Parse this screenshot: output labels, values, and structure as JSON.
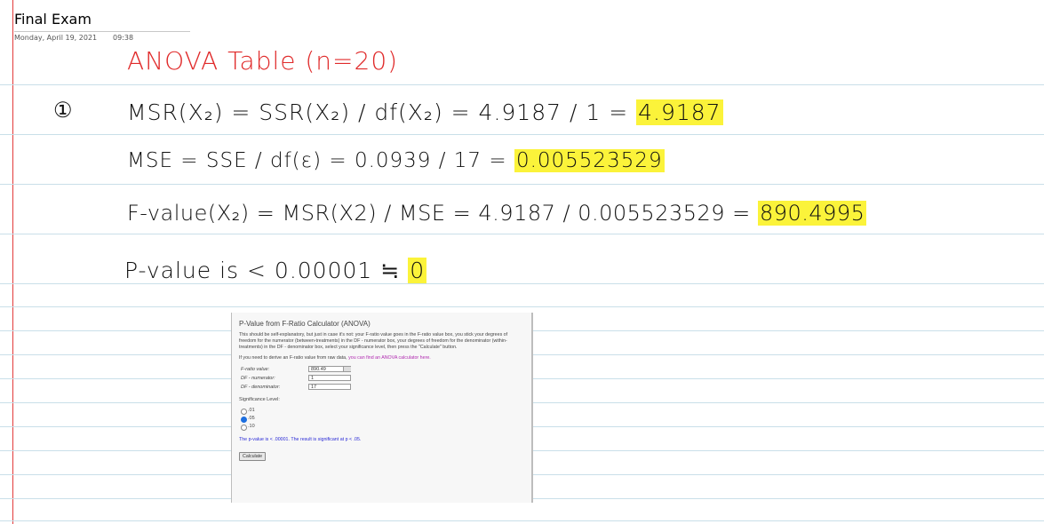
{
  "page": {
    "title": "Final Exam",
    "date": "Monday, April 19, 2021",
    "time": "09:38"
  },
  "notes": {
    "heading": "ANOVA Table  (n=20)",
    "item_number": "①",
    "msr_expr": "MSR(X₂) = SSR(X₂) / df(X₂) = 4.9187 / 1 =",
    "msr_result": "4.9187",
    "mse_expr": "MSE = SSE / df(ε) = 0.0939 / 17 =",
    "mse_result": "0.005523529",
    "f_expr": "F-value(X₂) = MSR(X2) / MSE = 4.9187 / 0.005523529 =",
    "f_result": "890.4995",
    "p_expr": "P-value is < 0.00001 ≒",
    "p_result": "0"
  },
  "calculator": {
    "title": "P-Value from F-Ratio Calculator (ANOVA)",
    "description": "This should be self-explanatory, but just in case it's not: your F-ratio value goes in the F-ratio value box, you stick your degrees of freedom for the numerator (between-treatments) in the DF - numerator box, your degrees of freedom for the denominator (within-treatments) in the DF - denominator box, select your significance level, then press the \"Calculate\" button.",
    "derive_text": "If you need to derive an F-ratio value from raw data,",
    "derive_link": "you can find an ANOVA calculator here.",
    "fields": [
      {
        "label": "F-ratio value:",
        "value": "890.49"
      },
      {
        "label": "DF - numerator:",
        "value": "1"
      },
      {
        "label": "DF - denominator:",
        "value": "17"
      }
    ],
    "significance_label": "Significance Level:",
    "options": [
      {
        "label": ".01",
        "selected": false
      },
      {
        "label": ".05",
        "selected": true
      },
      {
        "label": ".10",
        "selected": false
      }
    ],
    "result": "The p-value is < .00001. The result is significant at p < .05.",
    "button": "Calculate"
  },
  "colors": {
    "rule": "#c9dfe9",
    "margin": "#e23b3b",
    "heading": "#e02a2a",
    "highlight": "#fbf33a",
    "link": "#b02ab0",
    "result": "#2b2bd6"
  }
}
